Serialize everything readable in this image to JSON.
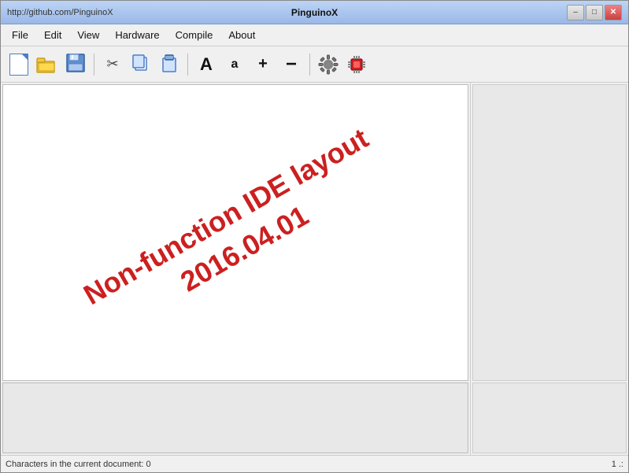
{
  "titlebar": {
    "url": "http://github.com/PinguinoX",
    "title": "PinguinoX",
    "minimize_label": "–",
    "maximize_label": "□",
    "close_label": "✕"
  },
  "menubar": {
    "items": [
      {
        "label": "File",
        "id": "file"
      },
      {
        "label": "Edit",
        "id": "edit"
      },
      {
        "label": "View",
        "id": "view"
      },
      {
        "label": "Hardware",
        "id": "hardware"
      },
      {
        "label": "Compile",
        "id": "compile"
      },
      {
        "label": "About",
        "id": "about"
      }
    ]
  },
  "toolbar": {
    "buttons": [
      {
        "id": "new",
        "icon": "new-file-icon",
        "label": "New"
      },
      {
        "id": "open",
        "icon": "open-folder-icon",
        "label": "Open"
      },
      {
        "id": "save",
        "icon": "save-icon",
        "label": "Save"
      },
      {
        "id": "cut",
        "icon": "cut-icon",
        "label": "Cut"
      },
      {
        "id": "copy",
        "icon": "copy-icon",
        "label": "Copy"
      },
      {
        "id": "paste",
        "icon": "paste-icon",
        "label": "Paste"
      },
      {
        "id": "font-large",
        "icon": "font-large-icon",
        "label": "Font Large"
      },
      {
        "id": "font-small",
        "icon": "font-small-icon",
        "label": "Font Small"
      },
      {
        "id": "zoom-in",
        "icon": "zoom-in-icon",
        "label": "Zoom In"
      },
      {
        "id": "zoom-out",
        "icon": "zoom-out-icon",
        "label": "Zoom Out"
      },
      {
        "id": "settings",
        "icon": "gear-icon",
        "label": "Settings"
      },
      {
        "id": "upload",
        "icon": "upload-icon",
        "label": "Upload"
      }
    ]
  },
  "editor": {
    "watermark_line1": "Non-function IDE layout",
    "watermark_line2": "2016.04.01"
  },
  "statusbar": {
    "left": "Characters in the current document: 0",
    "right": "1 .:"
  }
}
